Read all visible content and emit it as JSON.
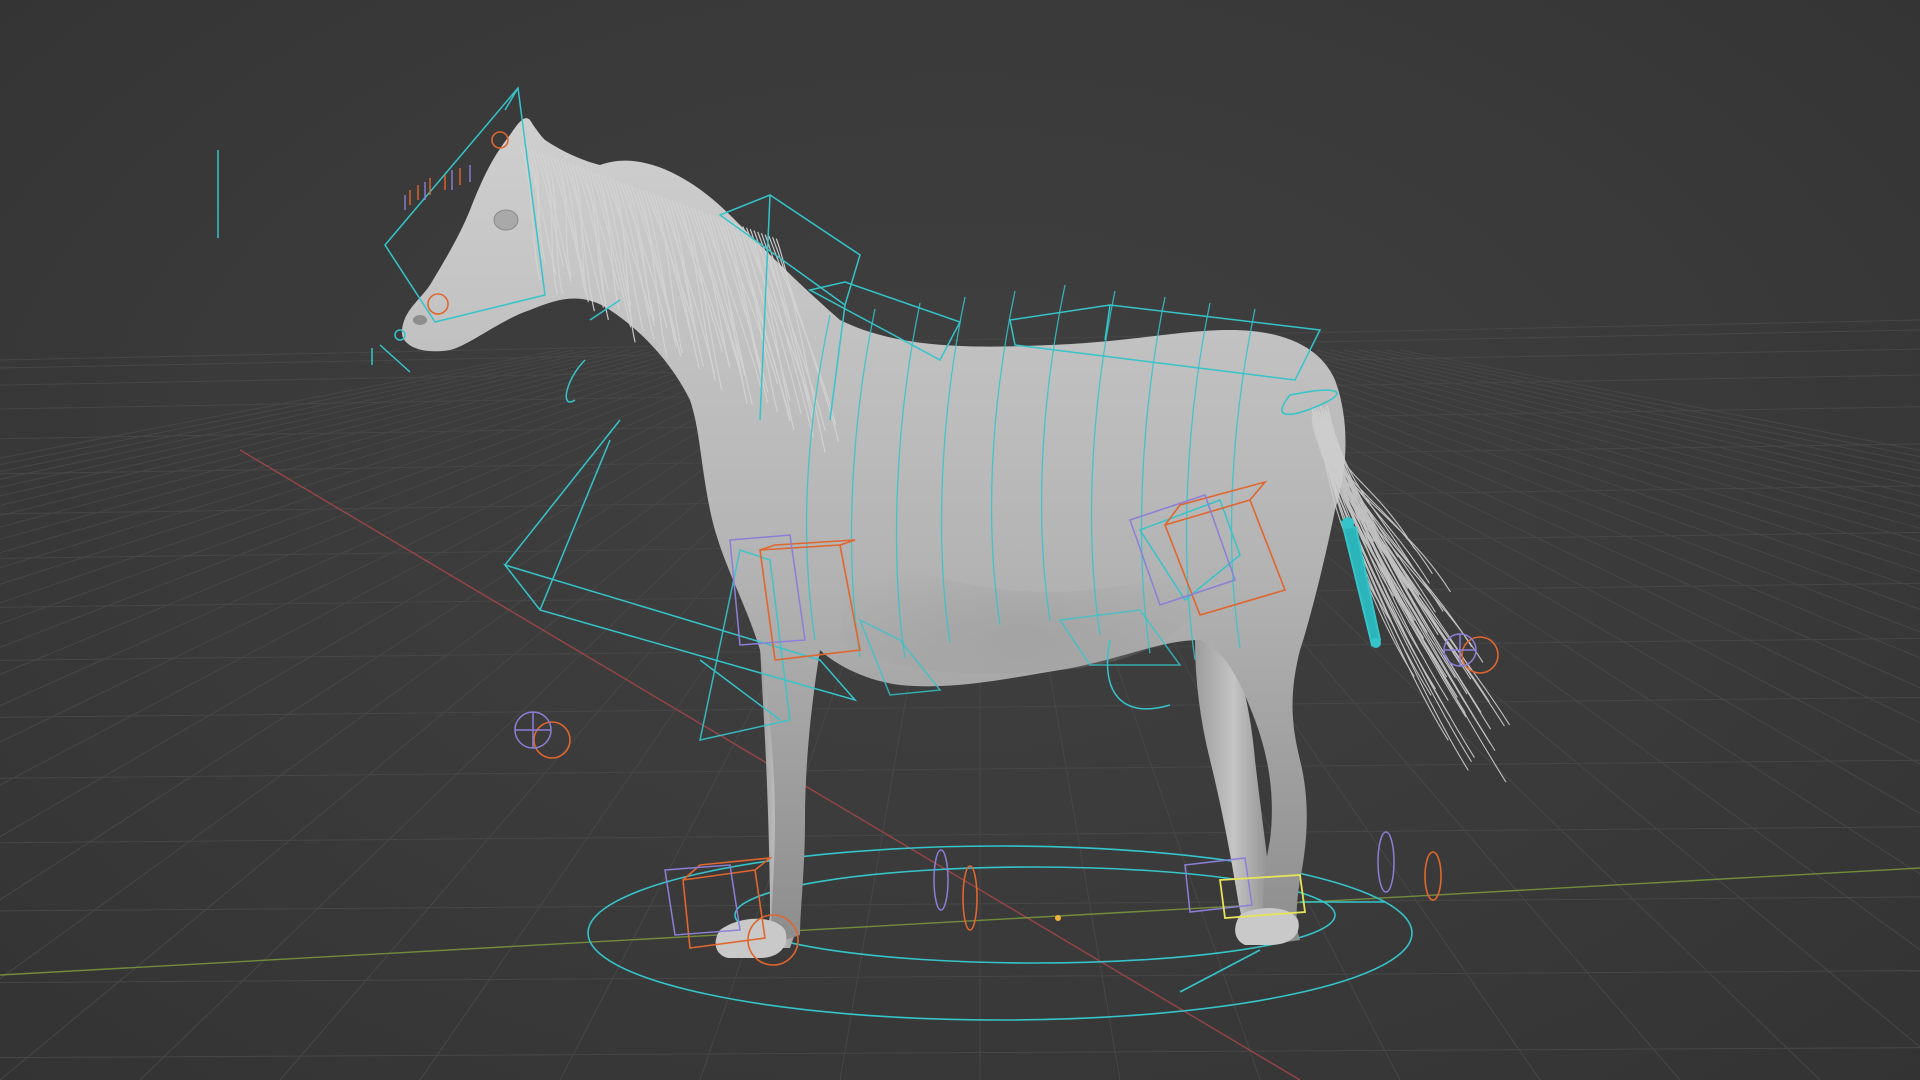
{
  "viewport": {
    "background": "#3a3a3a",
    "grid_color": "#4a4a4a",
    "x_axis_color": "#b0474a",
    "y_axis_color": "#7f9a3c"
  },
  "scene": {
    "subject": "horse",
    "mesh_color": "#b9b9b9",
    "rig_colors": {
      "control_primary": "#35c4c9",
      "control_fk": "#e0662f",
      "control_ik": "#8b7fd6",
      "control_selected": "#e6e35a"
    }
  }
}
